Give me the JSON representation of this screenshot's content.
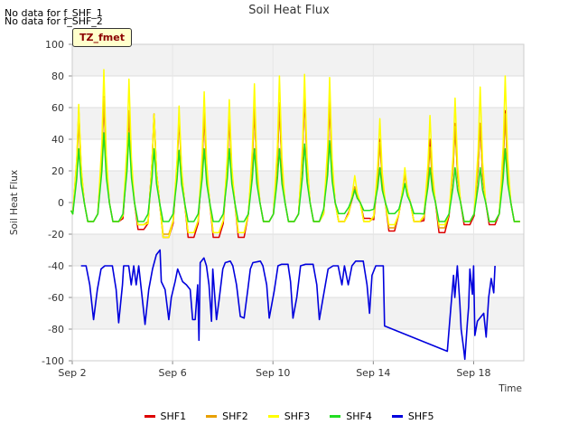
{
  "nodata_lines": [
    "No data for f_SHF_1",
    "No data for f_SHF_2"
  ],
  "badge_label": "TZ_fmet",
  "chart_data": {
    "type": "line",
    "title": "Soil Heat Flux",
    "xlabel": "Time",
    "ylabel": "Soil Heat Flux",
    "xlim": [
      0,
      18
    ],
    "ylim": [
      -100,
      100
    ],
    "yticks": [
      -100,
      -80,
      -60,
      -40,
      -20,
      0,
      20,
      40,
      60,
      80,
      100
    ],
    "xticks": [
      {
        "value": 0,
        "label": "Sep 2"
      },
      {
        "value": 4,
        "label": "Sep 6"
      },
      {
        "value": 8,
        "label": "Sep 10"
      },
      {
        "value": 12,
        "label": "Sep 14"
      },
      {
        "value": 16,
        "label": "Sep 18"
      }
    ],
    "x_unit": "days since Sep 2",
    "grid": true,
    "legend_position": "bottom",
    "series": [
      {
        "name": "SHF1",
        "color": "#dd0000",
        "days": [
          0.3,
          1.3,
          2.3,
          3.3,
          4.3,
          5.3,
          6.3,
          7.3,
          8.3,
          9.3,
          10.3,
          11.3,
          12.3,
          13.3,
          14.3,
          15.3,
          16.3,
          17.3
        ],
        "peaks": [
          58,
          67,
          57,
          56,
          54,
          56,
          55,
          60,
          62,
          68,
          64,
          8,
          40,
          20,
          40,
          50,
          50,
          58
        ],
        "troughs": [
          -12,
          -12,
          -17,
          -22,
          -22,
          -22,
          -22,
          -12,
          -12,
          -12,
          -12,
          -10,
          -18,
          -12,
          -19,
          -14,
          -14,
          -12
        ]
      },
      {
        "name": "SHF2",
        "color": "#e8a000",
        "days": [
          0.3,
          1.3,
          2.3,
          3.3,
          4.3,
          5.3,
          6.3,
          7.3,
          8.3,
          9.3,
          10.3,
          11.3,
          12.3,
          13.3,
          14.3,
          15.3,
          16.3,
          17.3
        ],
        "peaks": [
          52,
          66,
          58,
          55,
          55,
          57,
          56,
          60,
          63,
          70,
          65,
          10,
          38,
          18,
          35,
          48,
          50,
          56
        ],
        "troughs": [
          -12,
          -12,
          -14,
          -20,
          -19,
          -19,
          -19,
          -12,
          -12,
          -12,
          -12,
          -12,
          -16,
          -12,
          -16,
          -12,
          -12,
          -12
        ]
      },
      {
        "name": "SHF3",
        "color": "#ffff00",
        "days": [
          0.3,
          1.3,
          2.3,
          3.3,
          4.3,
          5.3,
          6.3,
          7.3,
          8.3,
          9.3,
          10.3,
          11.3,
          12.3,
          13.3,
          14.3,
          15.3,
          16.3,
          17.3
        ],
        "peaks": [
          62,
          84,
          78,
          56,
          61,
          70,
          65,
          75,
          80,
          81,
          79,
          17,
          53,
          22,
          55,
          66,
          73,
          80
        ],
        "troughs": [
          -12,
          -12,
          -14,
          -22,
          -19,
          -19,
          -19,
          -12,
          -12,
          -12,
          -12,
          -12,
          -14,
          -12,
          -14,
          -12,
          -12,
          -12
        ]
      },
      {
        "name": "SHF4",
        "color": "#22dd22",
        "days": [
          0.3,
          1.3,
          2.3,
          3.3,
          4.3,
          5.3,
          6.3,
          7.3,
          8.3,
          9.3,
          10.3,
          11.3,
          12.3,
          13.3,
          14.3,
          15.3,
          16.3,
          17.3
        ],
        "peaks": [
          34,
          44,
          44,
          34,
          33,
          34,
          34,
          34,
          34,
          37,
          39,
          8,
          22,
          12,
          22,
          22,
          22,
          34
        ],
        "troughs": [
          -12,
          -12,
          -12,
          -12,
          -12,
          -12,
          -12,
          -12,
          -12,
          -12,
          -7,
          -5,
          -7,
          -7,
          -12,
          -12,
          -12,
          -12
        ]
      },
      {
        "name": "SHF5",
        "color": "#0000dd",
        "points": [
          [
            0.35,
            -40
          ],
          [
            0.55,
            -40
          ],
          [
            0.7,
            -52
          ],
          [
            0.85,
            -74
          ],
          [
            1.0,
            -55
          ],
          [
            1.15,
            -42
          ],
          [
            1.3,
            -40
          ],
          [
            1.6,
            -40
          ],
          [
            1.75,
            -55
          ],
          [
            1.85,
            -76
          ],
          [
            2.0,
            -52
          ],
          [
            2.05,
            -40
          ],
          [
            2.25,
            -40
          ],
          [
            2.35,
            -52
          ],
          [
            2.45,
            -40
          ],
          [
            2.55,
            -52
          ],
          [
            2.65,
            -40
          ],
          [
            2.8,
            -62
          ],
          [
            2.9,
            -77
          ],
          [
            3.05,
            -55
          ],
          [
            3.2,
            -42
          ],
          [
            3.35,
            -33
          ],
          [
            3.5,
            -30
          ],
          [
            3.55,
            -50
          ],
          [
            3.7,
            -55
          ],
          [
            3.85,
            -74
          ],
          [
            3.95,
            -60
          ],
          [
            4.1,
            -50
          ],
          [
            4.2,
            -42
          ],
          [
            4.3,
            -46
          ],
          [
            4.4,
            -50
          ],
          [
            4.55,
            -52
          ],
          [
            4.7,
            -55
          ],
          [
            4.8,
            -74
          ],
          [
            4.9,
            -74
          ],
          [
            5.0,
            -52
          ],
          [
            5.05,
            -87
          ],
          [
            5.1,
            -38
          ],
          [
            5.25,
            -35
          ],
          [
            5.35,
            -40
          ],
          [
            5.45,
            -52
          ],
          [
            5.55,
            -75
          ],
          [
            5.6,
            -42
          ],
          [
            5.75,
            -74
          ],
          [
            5.85,
            -62
          ],
          [
            6.0,
            -42
          ],
          [
            6.1,
            -38
          ],
          [
            6.3,
            -37
          ],
          [
            6.4,
            -40
          ],
          [
            6.55,
            -52
          ],
          [
            6.7,
            -72
          ],
          [
            6.85,
            -73
          ],
          [
            7.0,
            -55
          ],
          [
            7.1,
            -42
          ],
          [
            7.2,
            -38
          ],
          [
            7.5,
            -37
          ],
          [
            7.6,
            -40
          ],
          [
            7.75,
            -52
          ],
          [
            7.85,
            -73
          ],
          [
            8.05,
            -56
          ],
          [
            8.2,
            -40
          ],
          [
            8.35,
            -39
          ],
          [
            8.6,
            -39
          ],
          [
            8.7,
            -50
          ],
          [
            8.8,
            -73
          ],
          [
            8.95,
            -60
          ],
          [
            9.1,
            -40
          ],
          [
            9.3,
            -39
          ],
          [
            9.6,
            -39
          ],
          [
            9.75,
            -52
          ],
          [
            9.85,
            -74
          ],
          [
            10.0,
            -60
          ],
          [
            10.2,
            -42
          ],
          [
            10.4,
            -40
          ],
          [
            10.6,
            -40
          ],
          [
            10.75,
            -52
          ],
          [
            10.85,
            -40
          ],
          [
            11.0,
            -52
          ],
          [
            11.15,
            -40
          ],
          [
            11.3,
            -37
          ],
          [
            11.6,
            -37
          ],
          [
            11.75,
            -52
          ],
          [
            11.85,
            -70
          ],
          [
            11.95,
            -46
          ],
          [
            12.1,
            -40
          ],
          [
            12.4,
            -40
          ],
          [
            12.45,
            -78
          ],
          [
            14.95,
            -94
          ],
          [
            15.0,
            -84
          ],
          [
            15.1,
            -65
          ],
          [
            15.2,
            -46
          ],
          [
            15.25,
            -60
          ],
          [
            15.35,
            -40
          ],
          [
            15.45,
            -64
          ],
          [
            15.5,
            -80
          ],
          [
            15.6,
            -92
          ],
          [
            15.65,
            -99
          ],
          [
            15.75,
            -76
          ],
          [
            15.8,
            -66
          ],
          [
            15.85,
            -42
          ],
          [
            15.95,
            -58
          ],
          [
            16.0,
            -40
          ],
          [
            16.05,
            -84
          ],
          [
            16.15,
            -75
          ],
          [
            16.4,
            -70
          ],
          [
            16.5,
            -85
          ],
          [
            16.6,
            -60
          ],
          [
            16.7,
            -48
          ],
          [
            16.8,
            -57
          ],
          [
            16.85,
            -40
          ]
        ]
      }
    ]
  }
}
